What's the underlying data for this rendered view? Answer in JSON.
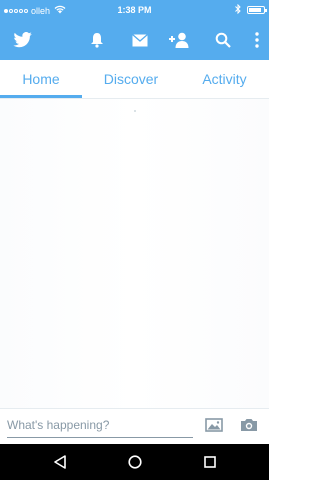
{
  "status_bar": {
    "carrier": "olleh",
    "time": "1:38 PM",
    "battery_level": 0.85,
    "signal_bars_filled": 1,
    "signal_bars_total": 5
  },
  "app_bar": {
    "color": "#55acee",
    "icons": [
      "twitter-bird-icon",
      "notifications-icon",
      "messages-icon",
      "add-user-icon",
      "search-icon",
      "overflow-menu-icon"
    ]
  },
  "tabs": [
    {
      "label": "Home",
      "active": true
    },
    {
      "label": "Discover",
      "active": false
    },
    {
      "label": "Activity",
      "active": false
    }
  ],
  "composer": {
    "placeholder": "What's happening?"
  },
  "nav_bar": {
    "icons": [
      "back-icon",
      "home-icon",
      "recent-apps-icon"
    ]
  }
}
